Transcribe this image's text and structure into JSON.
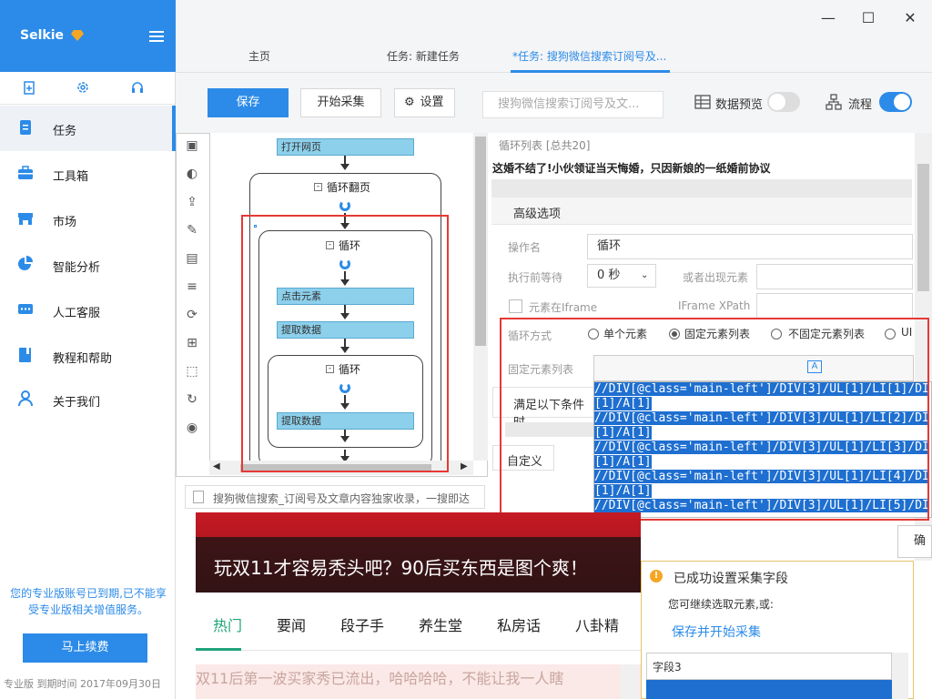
{
  "app": {
    "brand": "Selkie"
  },
  "sidebar": {
    "items": [
      {
        "label": "任务",
        "icon": "task-doc-icon"
      },
      {
        "label": "工具箱",
        "icon": "toolbox-icon"
      },
      {
        "label": "市场",
        "icon": "store-icon"
      },
      {
        "label": "智能分析",
        "icon": "pie-chart-icon"
      },
      {
        "label": "人工客服",
        "icon": "chat-icon"
      },
      {
        "label": "教程和帮助",
        "icon": "book-icon"
      },
      {
        "label": "关于我们",
        "icon": "user-icon"
      }
    ],
    "notice": "您的专业版账号已到期,已不能享受专业版相关增值服务。",
    "renew_label": "马上续费",
    "footer": "专业版 到期时间 2017年09月30日"
  },
  "tabs": [
    {
      "label": "主页"
    },
    {
      "label": "任务: 新建任务"
    },
    {
      "label": "*任务: 搜狗微信搜索订阅号及..."
    }
  ],
  "toolbar": {
    "save_label": "保存",
    "start_label": "开始采集",
    "settings_label": "设置",
    "task_name": "搜狗微信搜索订阅号及文...",
    "data_preview_label": "数据预览",
    "flow_label": "流程"
  },
  "flow": {
    "open_page": "打开网页",
    "loop_page": "循环翻页",
    "loop1": "循环",
    "click_element": "点击元素",
    "extract1": "提取数据",
    "loop2": "循环",
    "extract2": "提取数据"
  },
  "panel": {
    "list_title": "循环列表 [总共20]",
    "list_item": "这婚不结了!小伙领证当天悔婚，只因新娘的一纸婚前协议",
    "advanced_label": "高级选项",
    "op_name_label": "操作名",
    "op_name_value": "循环",
    "wait_label": "执行前等待",
    "wait_value": "0 秒",
    "or_appear_label": "或者出现元素",
    "iframe_label": "元素在Iframe",
    "iframe_xpath_label": "IFrame XPath",
    "loop_mode_label": "循环方式",
    "loop_modes": [
      "单个元素",
      "固定元素列表",
      "不固定元素列表",
      "UI"
    ],
    "fixed_list_label": "固定元素列表",
    "condition_label": "满足以下条件时",
    "custom_label": "自定义",
    "confirm_label": "确定",
    "xpaths": [
      "//DIV[@class='main-left']/DIV[3]/UL[1]/LI[1]/DI",
      "[1]/A[1]",
      "//DIV[@class='main-left']/DIV[3]/UL[1]/LI[2]/DI",
      "[1]/A[1]",
      "//DIV[@class='main-left']/DIV[3]/UL[1]/LI[3]/DI",
      "[1]/A[1]",
      "//DIV[@class='main-left']/DIV[3]/UL[1]/LI[4]/DI",
      "[1]/A[1]",
      "//DIV[@class='main-left']/DIV[3]/UL[1]/LI[5]/DI"
    ]
  },
  "web": {
    "status_text": "搜狗微信搜索_订阅号及文章内容独家收录，一搜即达",
    "hero_title": "玩双11才容易秃头吧？90后买东西是图个爽！",
    "categories": [
      "热门",
      "要闻",
      "段子手",
      "养生堂",
      "私房话",
      "八卦精"
    ],
    "news_line": "双11后第一波买家秀已流出，哈哈哈哈，不能让我一人瞎"
  },
  "tip": {
    "title": "已成功设置采集字段",
    "subtitle": "您可继续选取元素,或:",
    "action": "保存并开始采集",
    "field": "字段3"
  },
  "colors": {
    "accent": "#2c8be8",
    "highlight": "#e53935",
    "category_active": "#1fa37a"
  }
}
